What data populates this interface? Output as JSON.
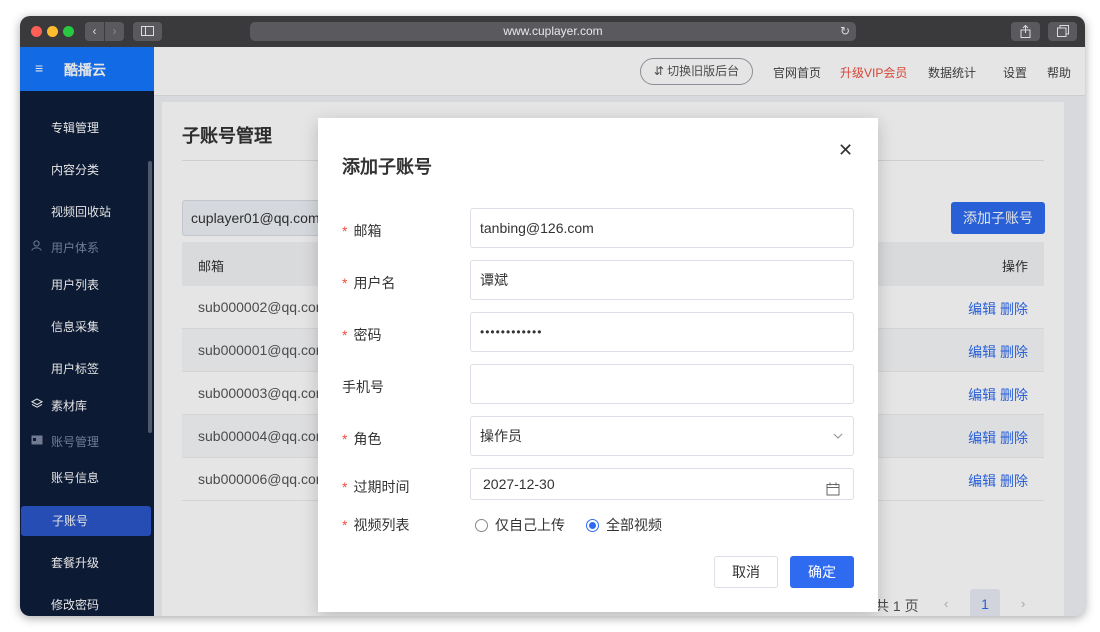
{
  "browser": {
    "url": "www.cuplayer.com",
    "back_glyph": "‹",
    "forward_glyph": "›",
    "reload_glyph": "↻"
  },
  "app": {
    "brand": "酷播云",
    "menu_glyph": "≡"
  },
  "topbar": {
    "switch_label": "⇵ 切换旧版后台",
    "links": [
      "官网首页",
      "升级VIP会员",
      "数据统计",
      "设置",
      "帮助"
    ]
  },
  "sidebar": {
    "items": [
      "专辑管理",
      "内容分类",
      "视频回收站"
    ],
    "group_user": "用户体系",
    "user_items": [
      "用户列表",
      "信息采集",
      "用户标签"
    ],
    "material": "素材库",
    "group_account": "账号管理",
    "account_items": [
      "账号信息",
      "子账号",
      "套餐升级",
      "修改密码"
    ]
  },
  "page": {
    "title": "子账号管理",
    "filter_value": "cuplayer01@qq.com",
    "add_button": "添加子账号",
    "columns": {
      "email": "邮箱",
      "ops": "操作"
    },
    "rows": [
      {
        "email": "sub000002@qq.com",
        "ops": "编辑 删除"
      },
      {
        "email": "sub000001@qq.com",
        "ops": "编辑 删除"
      },
      {
        "email": "sub000003@qq.com",
        "ops": "编辑 删除"
      },
      {
        "email": "sub000004@qq.com",
        "ops": "编辑 删除"
      },
      {
        "email": "sub000006@qq.com",
        "ops": "编辑 删除"
      }
    ],
    "pager": {
      "total": "共 1 页",
      "prev": "‹",
      "current": "1",
      "next": "›"
    }
  },
  "dialog": {
    "title": "添加子账号",
    "close_glyph": "✕",
    "required_mark": "*",
    "fields": {
      "email": {
        "label": "邮箱",
        "value": "tanbing@126.com"
      },
      "username": {
        "label": "用户名",
        "value": "谭斌"
      },
      "password": {
        "label": "密码",
        "value": "••••••••••••"
      },
      "phone": {
        "label": "手机号",
        "value": ""
      },
      "role": {
        "label": "角色",
        "value": "操作员"
      },
      "expire": {
        "label": "过期时间",
        "value": "2027-12-30"
      },
      "videos": {
        "label": "视频列表",
        "options": [
          "仅自己上传",
          "全部视频"
        ],
        "selected": 1
      }
    },
    "cancel": "取消",
    "ok": "确定"
  },
  "colors": {
    "primary": "#2e6bf0",
    "brand_blue": "#1677ff",
    "sidebar_bg": "#0f1e3a",
    "vip_red": "#f04e3e"
  }
}
